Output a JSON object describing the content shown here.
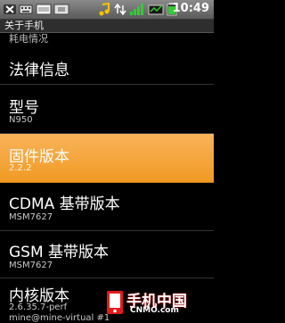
{
  "status_bar": {
    "time": "10:49",
    "icons": [
      "usb-debug-icon",
      "keyboard-icon",
      "sd-card-icon",
      "music-note-icon",
      "data-transfer-icon",
      "wifi-signal-icon",
      "battery-icon"
    ]
  },
  "title_bar": {
    "title": "关于手机"
  },
  "partial_item": {
    "text": "耗电情况"
  },
  "items": [
    {
      "title": "法律信息",
      "summary": ""
    },
    {
      "title": "型号",
      "summary": "N950"
    },
    {
      "title": "固件版本",
      "summary": "2.2.2",
      "selected": true
    },
    {
      "title": "CDMA 基带版本",
      "summary": "MSM7627"
    },
    {
      "title": "GSM 基带版本",
      "summary": "MSM7627"
    },
    {
      "title": "内核版本",
      "summary": "2.6.35.7-perf",
      "summary2": "mine@mine-virtual #1"
    }
  ],
  "watermark": {
    "cn": "手机中国",
    "en": "CNMO.com"
  },
  "colors": {
    "selected_start": "#f9b35a",
    "selected_end": "#f09a24",
    "statusbar": "#6e6e6e"
  }
}
